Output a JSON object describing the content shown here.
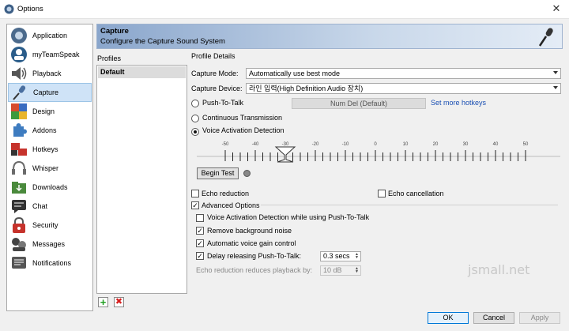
{
  "window": {
    "title": "Options",
    "close_glyph": "✕"
  },
  "sidebar": {
    "items": [
      {
        "label": "Application",
        "icon": "teamspeak-logo-icon",
        "color": "#4b6a8c"
      },
      {
        "label": "myTeamSpeak",
        "icon": "user-icon",
        "color": "#2b5d8a"
      },
      {
        "label": "Playback",
        "icon": "speaker-icon",
        "color": "#555555"
      },
      {
        "label": "Capture",
        "icon": "microphone-icon",
        "color": "#4a6fa0"
      },
      {
        "label": "Design",
        "icon": "palette-icon",
        "color": "#d64a2f"
      },
      {
        "label": "Addons",
        "icon": "puzzle-icon",
        "color": "#3e7cc0"
      },
      {
        "label": "Hotkeys",
        "icon": "keyboard-icon",
        "color": "#c6332c"
      },
      {
        "label": "Whisper",
        "icon": "headset-icon",
        "color": "#6b6b6b"
      },
      {
        "label": "Downloads",
        "icon": "folder-icon",
        "color": "#4a8a3c"
      },
      {
        "label": "Chat",
        "icon": "chat-icon",
        "color": "#333333"
      },
      {
        "label": "Security",
        "icon": "lock-icon",
        "color": "#c6332c"
      },
      {
        "label": "Messages",
        "icon": "messages-icon",
        "color": "#444444"
      },
      {
        "label": "Notifications",
        "icon": "notifications-icon",
        "color": "#555555"
      }
    ],
    "selected": "Capture"
  },
  "header": {
    "title": "Capture",
    "subtitle": "Configure the Capture Sound System"
  },
  "profiles": {
    "label": "Profiles",
    "items": [
      "Default"
    ],
    "add_glyph": "+",
    "delete_glyph": "✖"
  },
  "details": {
    "label": "Profile Details",
    "capture_mode": {
      "label": "Capture Mode:",
      "value": "Automatically use best mode"
    },
    "capture_device": {
      "label": "Capture Device:",
      "value": "라인 입력(High Definition Audio 장치)"
    },
    "push_to_talk": {
      "label": "Push-To-Talk",
      "selected": false,
      "hotkey": "Num Del (Default)",
      "more_link": "Set more hotkeys"
    },
    "continuous": {
      "label": "Continuous Transmission",
      "selected": false
    },
    "voice_activation": {
      "label": "Voice Activation Detection",
      "selected": true
    },
    "meter": {
      "tick_labels": [
        "-50",
        "-40",
        "-30",
        "-20",
        "-10",
        "0",
        "10",
        "20",
        "30",
        "40",
        "50"
      ],
      "min": -50,
      "max": 50,
      "threshold": -30
    },
    "begin_test": "Begin Test",
    "echo_reduction": {
      "label": "Echo reduction",
      "checked": false
    },
    "echo_cancellation": {
      "label": "Echo cancellation",
      "checked": false
    },
    "advanced": {
      "label": "Advanced Options",
      "checked": true,
      "vad_while_ptt": {
        "label": "Voice Activation Detection while using Push-To-Talk",
        "checked": false
      },
      "remove_noise": {
        "label": "Remove background noise",
        "checked": true
      },
      "agc": {
        "label": "Automatic voice gain control",
        "checked": true
      },
      "delay_release": {
        "label": "Delay releasing Push-To-Talk:",
        "checked": true,
        "value": "0.3 secs"
      },
      "echo_playback": {
        "label": "Echo reduction reduces playback by:",
        "value": "10 dB"
      }
    }
  },
  "watermark": "jsmall.net",
  "buttons": {
    "ok": "OK",
    "cancel": "Cancel",
    "apply": "Apply"
  }
}
